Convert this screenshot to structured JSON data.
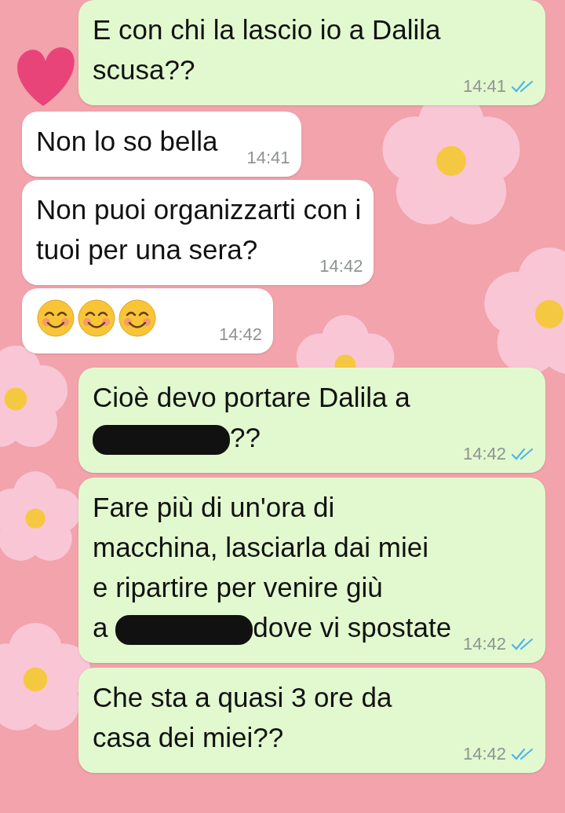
{
  "messages": [
    {
      "outgoing": true,
      "lines": [
        [
          "E con chi la lascio io a Dalila"
        ],
        [
          "scusa??"
        ]
      ],
      "time": "14:41",
      "read": true
    },
    {
      "outgoing": false,
      "lines": [
        [
          "Non lo so bella"
        ]
      ],
      "time": "14:41"
    },
    {
      "outgoing": false,
      "lines": [
        [
          "Non puoi organizzarti con i"
        ],
        [
          "tuoi per una sera?"
        ]
      ],
      "time": "14:42"
    },
    {
      "outgoing": false,
      "kind": "emoji",
      "emojis": [
        {
          "kind": "smile"
        },
        {
          "kind": "smile"
        },
        {
          "kind": "smile"
        }
      ],
      "time": "14:42"
    },
    {
      "outgoing": true,
      "lines": [
        [
          "Cioè devo portare Dalila a"
        ],
        [
          {
            "kind": "redacted"
          },
          "??"
        ]
      ],
      "time": "14:42",
      "read": true
    },
    {
      "outgoing": true,
      "lines": [
        [
          "Fare più di un'ora di"
        ],
        [
          "macchina, lasciarla dai miei"
        ],
        [
          "e ripartire per venire giù"
        ],
        [
          "a ",
          {
            "kind": "redacted"
          },
          "dove vi spostate"
        ]
      ],
      "time": "14:42",
      "read": true
    },
    {
      "outgoing": true,
      "lines": [
        [
          "Che sta a quasi 3 ore da"
        ],
        [
          "casa dei miei??"
        ]
      ],
      "time": "14:42",
      "read": true
    }
  ]
}
